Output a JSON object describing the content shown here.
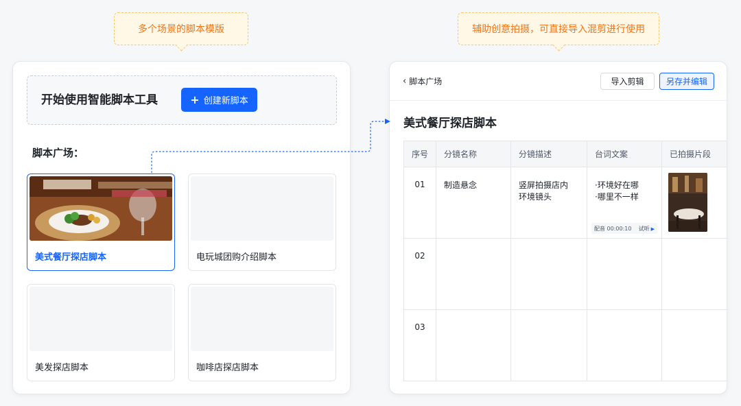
{
  "callouts": {
    "left": "多个场景的脚本模版",
    "right": "辅助创意拍摄，可直接导入混剪进行使用"
  },
  "left_panel": {
    "start_title": "开始使用智能脚本工具",
    "create_button": "创建新脚本",
    "square_title": "脚本广场：",
    "templates": [
      {
        "label": "美式餐厅探店脚本",
        "selected": true,
        "has_image": true
      },
      {
        "label": "电玩城团购介绍脚本",
        "selected": false,
        "has_image": false
      },
      {
        "label": "美发探店脚本",
        "selected": false,
        "has_image": false
      },
      {
        "label": "咖啡店探店脚本",
        "selected": false,
        "has_image": false
      }
    ]
  },
  "right_panel": {
    "back_label": "脚本广场",
    "import_button": "导入剪辑",
    "save_button": "另存并编辑",
    "script_title": "美式餐厅探店脚本",
    "table": {
      "headers": [
        "序号",
        "分镜名称",
        "分镜描述",
        "台词文案",
        "已拍摄片段"
      ],
      "rows": [
        {
          "no": "01",
          "name": "制造悬念",
          "description": [
            "竖屏拍摄店内",
            "环境镜头"
          ],
          "lines": [
            "环境好在哪",
            "哪里不一样"
          ],
          "voiceover_label": "配音 00:00:10",
          "listen_label": "试听",
          "has_clip": true
        },
        {
          "no": "02",
          "name": "",
          "description": [],
          "lines": [],
          "has_clip": false
        },
        {
          "no": "03",
          "name": "",
          "description": [],
          "lines": [],
          "has_clip": false
        }
      ]
    }
  },
  "colors": {
    "accent": "#1664ff",
    "callout_text": "#f0761c",
    "callout_bg": "#fff8e6"
  },
  "icons": [
    "plus-icon",
    "chevron-left-icon",
    "play-icon",
    "food-photo",
    "restaurant-photo"
  ]
}
